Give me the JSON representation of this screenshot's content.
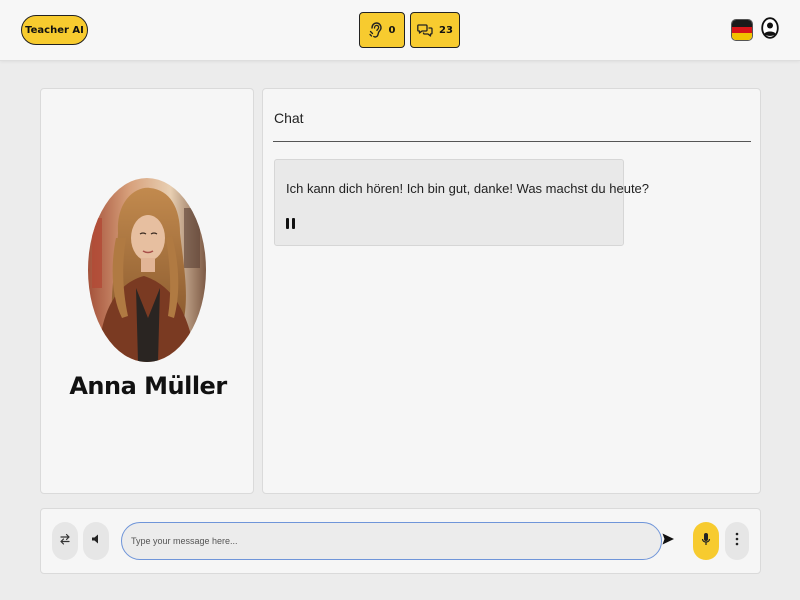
{
  "header": {
    "brand_label": "Teacher AI",
    "listen_count": "0",
    "chat_count": "23",
    "listen_icon": "ear-icon",
    "chat_icon": "chat-bubbles-icon",
    "language_flag": "germany-flag",
    "profile_icon": "user-circle-icon"
  },
  "persona": {
    "name": "Anna Müller",
    "avatar": "portrait-photo"
  },
  "chat": {
    "title": "Chat",
    "messages": [
      {
        "text": "Ich kann dich hören! Ich bin gut, danke! Was machst du heute?",
        "audio_state": "playing",
        "control_icon": "pause-icon"
      }
    ]
  },
  "composer": {
    "placeholder": "Type your message here...",
    "value": "",
    "icons": [
      "swap-icon",
      "speaker-icon",
      "send-icon",
      "microphone-icon",
      "more-vertical-icon"
    ]
  },
  "colors": {
    "accent": "#f7cb2f",
    "background": "#ececec",
    "panel": "#f6f6f6",
    "input_border": "#6f95d9"
  }
}
